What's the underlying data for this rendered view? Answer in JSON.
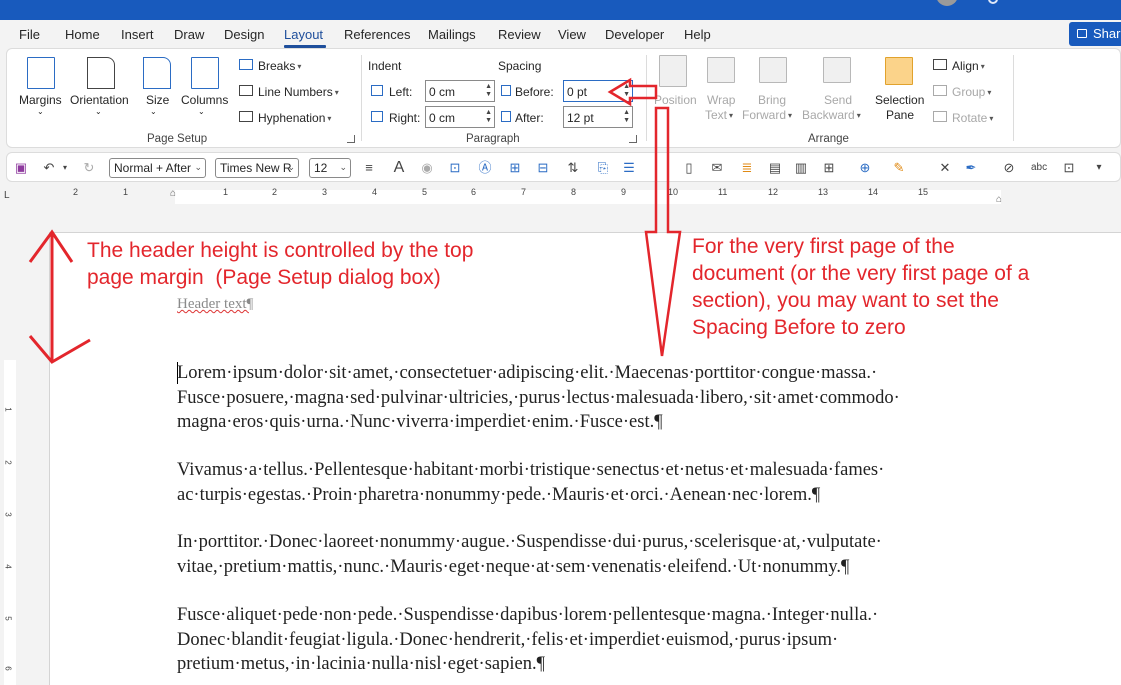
{
  "menu": {
    "items": [
      "File",
      "Home",
      "Insert",
      "Draw",
      "Design",
      "Layout",
      "References",
      "Mailings",
      "Review",
      "View",
      "Developer",
      "Help"
    ],
    "active": "Layout",
    "share_label": "Share"
  },
  "ribbon": {
    "page_setup": {
      "margins": "Margins",
      "orientation": "Orientation",
      "size": "Size",
      "columns": "Columns",
      "breaks": "Breaks",
      "line_numbers": "Line Numbers",
      "hyphenation": "Hyphenation",
      "group_label": "Page Setup"
    },
    "paragraph": {
      "indent_label": "Indent",
      "spacing_label": "Spacing",
      "left_label": "Left:",
      "left_value": "0 cm",
      "right_label": "Right:",
      "right_value": "0 cm",
      "before_label": "Before:",
      "before_value": "0 pt",
      "after_label": "After:",
      "after_value": "12 pt",
      "group_label": "Paragraph"
    },
    "arrange": {
      "position": "Position",
      "wrap_text_1": "Wrap",
      "wrap_text_2": "Text",
      "bring_forward_1": "Bring",
      "bring_forward_2": "Forward",
      "send_backward_1": "Send",
      "send_backward_2": "Backward",
      "selection_pane_1": "Selection",
      "selection_pane_2": "Pane",
      "align": "Align",
      "group": "Group",
      "rotate": "Rotate",
      "group_label": "Arrange"
    }
  },
  "qat": {
    "style": "Normal + After",
    "font": "Times New R",
    "size": "12"
  },
  "ruler": {
    "numbers": [
      "2",
      "1",
      "1",
      "2",
      "3",
      "4",
      "5",
      "6",
      "7",
      "8",
      "9",
      "10",
      "11",
      "12",
      "13",
      "14",
      "15"
    ]
  },
  "vruler": {
    "numbers": [
      "1",
      "2",
      "3",
      "4",
      "5",
      "6"
    ]
  },
  "document": {
    "header": "Header text¶",
    "paragraphs": [
      "Lorem·ipsum·dolor·sit·amet,·consectetuer·adipiscing·elit.·Maecenas·porttitor·congue·massa.·\nFusce·posuere,·magna·sed·pulvinar·ultricies,·purus·lectus·malesuada·libero,·sit·amet·commodo·\nmagna·eros·quis·urna.·Nunc·viverra·imperdiet·enim.·Fusce·est.¶",
      "Vivamus·a·tellus.·Pellentesque·habitant·morbi·tristique·senectus·et·netus·et·malesuada·fames·\nac·turpis·egestas.·Proin·pharetra·nonummy·pede.·Mauris·et·orci.·Aenean·nec·lorem.¶",
      "In·porttitor.·Donec·laoreet·nonummy·augue.·Suspendisse·dui·purus,·scelerisque·at,·vulputate·\nvitae,·pretium·mattis,·nunc.·Mauris·eget·neque·at·sem·venenatis·eleifend.·Ut·nonummy.¶",
      "Fusce·aliquet·pede·non·pede.·Suspendisse·dapibus·lorem·pellentesque·magna.·Integer·nulla.·\nDonec·blandit·feugiat·ligula.·Donec·hendrerit,·felis·et·imperdiet·euismod,·purus·ipsum·\npretium·metus,·in·lacinia·nulla·nisl·eget·sapien.¶"
    ]
  },
  "annotations": {
    "left": "The header height is controlled by the top\npage margin  (Page Setup dialog box)",
    "right": "For the very first page of the\ndocument (or the very first page of a\nsection), you may want to set the\nSpacing Before to zero"
  },
  "colors": {
    "accent": "#185abd",
    "annotation": "#e3262c"
  }
}
